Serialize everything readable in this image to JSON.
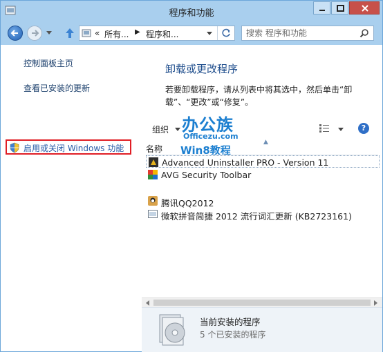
{
  "window": {
    "title": "程序和功能"
  },
  "nav": {
    "breadcrumb": [
      "«",
      "所有...",
      "程序和..."
    ],
    "search_placeholder": "搜索 程序和功能"
  },
  "left_pane": {
    "links": [
      "控制面板主页",
      "查看已安装的更新",
      "启用或关闭 Windows 功能"
    ]
  },
  "content": {
    "heading": "卸载或更改程序",
    "description": "若要卸载程序，请从列表中将其选中，然后单击“卸载”、“更改”或“修复”。",
    "organize_label": "组织",
    "column_name": "名称",
    "programs": [
      {
        "name": "Advanced Uninstaller PRO - Version 11",
        "icon": "advanced-uninstaller-icon"
      },
      {
        "name": "AVG Security Toolbar",
        "icon": "avg-icon"
      },
      {
        "name": "腾讯QQ2012",
        "icon": "qq-icon"
      },
      {
        "name": "微软拼音简捷 2012 流行词汇更新 (KB2723161)",
        "icon": "installer-icon"
      }
    ]
  },
  "watermark": {
    "main": "办公族",
    "sub": "Officezu.com",
    "sub2": "Win8教程"
  },
  "details": {
    "title": "当前安装的程序",
    "subtitle": "5 个已安装的程序"
  },
  "colors": {
    "accent": "#1e4d8c",
    "link": "#1a3e6b",
    "highlight": "#e01d24",
    "titlebar": "#a9cfee"
  }
}
